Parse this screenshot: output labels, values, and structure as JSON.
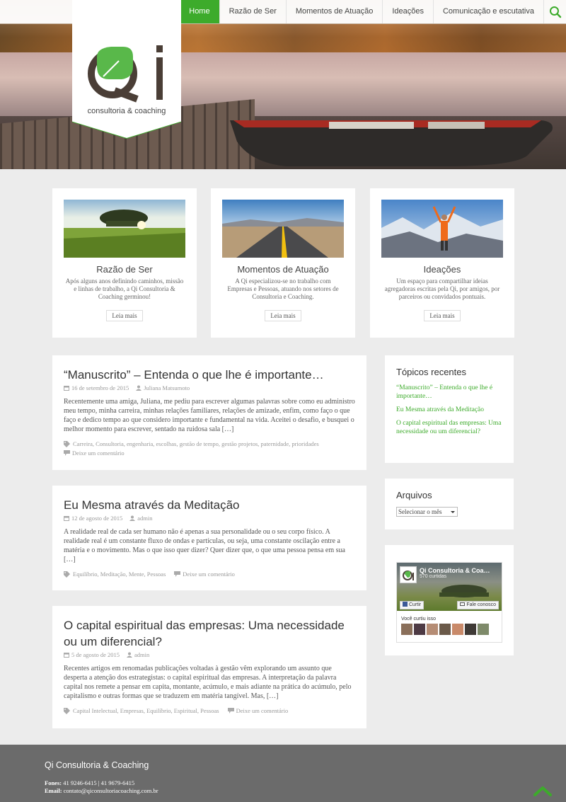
{
  "nav": {
    "items": [
      {
        "label": "Home",
        "active": true
      },
      {
        "label": "Razão de Ser",
        "active": false
      },
      {
        "label": "Momentos de Atuação",
        "active": false
      },
      {
        "label": "Ideações",
        "active": false
      },
      {
        "label": "Comunicação e escutativa",
        "active": false
      }
    ],
    "search_icon": "search-icon"
  },
  "brand": {
    "tagline": "consultoria & coaching",
    "accent": "#3dab2b",
    "logo_dark": "#4a3e36"
  },
  "features": [
    {
      "title": "Razão de Ser",
      "text": "Após alguns anos definindo caminhos, missão e linhas de trabalho, a Qi Consultoria & Coaching germinou!",
      "button": "Leia mais"
    },
    {
      "title": "Momentos de Atuação",
      "text": "A Qi especializou-se no trabalho com Empresas e Pessoas, atuando nos setores de Consultoria e Coaching.",
      "button": "Leia mais"
    },
    {
      "title": "Ideações",
      "text": "Um espaço para compartilhar ideias agregadoras escritas pela Qi, por amigos, por parceiros ou convidados pontuais.",
      "button": "Leia mais"
    }
  ],
  "posts": [
    {
      "title": "“Manuscrito” –  Entenda o que lhe é importante…",
      "date": "16 de setembro de 2015",
      "author": "Juliana Matsumoto",
      "excerpt": "  Recentemente uma amiga, Juliana, me pediu para escrever algumas palavras sobre como eu administro meu tempo, minha carreira, minhas relações familiares, relações de amizade, enfim, como faço o que faço e dedico tempo ao que considero importante e fundamental na vida. Aceitei o desafio, e busquei o melhor momento para escrever, sentado na ruidosa sala […]",
      "tags": "Carreira, Consultoria, engenharia, escolhas, gestão de tempo, gestão projetos, paternidade, prioridades",
      "comment": "Deixe um comentário"
    },
    {
      "title": "Eu Mesma através da Meditação",
      "date": "12 de agosto de 2015",
      "author": "admin",
      "excerpt": "A realidade real de cada ser humano não  é apenas a sua personalidade ou o seu corpo físico. A realidade real é um constante fluxo de ondas e partículas, ou seja, uma constante oscilação entre a matéria e o movimento. Mas o que isso quer dizer? Quer dizer que, o que uma pessoa pensa em sua […]",
      "tags": "Equilíbrio, Meditação, Mente, Pessoas",
      "comment": "Deixe um comentário"
    },
    {
      "title": "O capital espiritual das empresas: Uma necessidade ou um diferencial?",
      "date": "5 de agosto de 2015",
      "author": "admin",
      "excerpt": "Recentes artigos em renomadas publicações voltadas à gestão vêm explorando um assunto que desperta a atenção dos estrategistas: o capital espiritual das empresas. A interpretação da palavra capital nos remete a pensar em capita, montante, acúmulo, e mais adiante na prática do acúmulo, pelo capitalismo e outras formas que se traduzem em matéria tangível. Mas, […]",
      "tags": "Capital Intelectual, Empresas, Equilíbrio, Espiritual, Pessoas",
      "comment": "Deixe um comentário"
    }
  ],
  "sidebar": {
    "recent_title": "Tópicos recentes",
    "recent": [
      "“Manuscrito” –  Entenda o que lhe é importante…",
      "Eu Mesma através da Meditação",
      "O capital espiritual das empresas: Uma necessidade ou um diferencial?"
    ],
    "archives_title": "Arquivos",
    "archives_select": "Selecionar o mês",
    "facebook": {
      "page_name": "Qi Consultoria & Coa…",
      "likes": "570 curtidas",
      "like_button": "Curtir",
      "contact_button": "Fale conosco",
      "liked_text": "Você curtiu isso"
    }
  },
  "footer": {
    "title": "Qi Consultoria & Coaching",
    "phones_label": "Fones:",
    "phones": " 41 9246-6415   |   41 9679-6415",
    "email_label": "Email:",
    "email": " contato@qiconsultoriacoaching.com.br"
  }
}
